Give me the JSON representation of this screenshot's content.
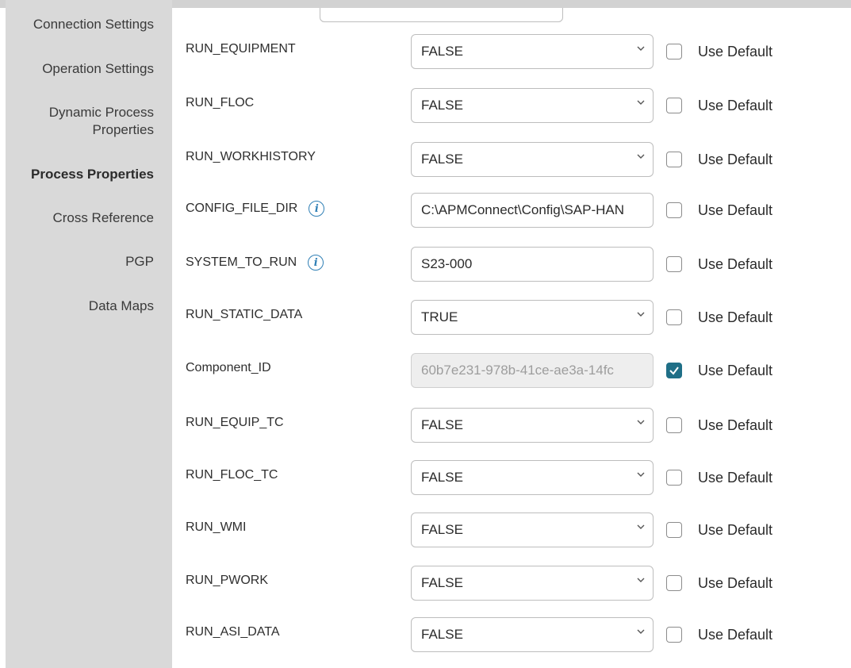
{
  "sidebar": {
    "items": [
      {
        "label": "Connection Settings",
        "active": false
      },
      {
        "label": "Operation Settings",
        "active": false
      },
      {
        "label": "Dynamic Process\nProperties",
        "active": false
      },
      {
        "label": "Process Properties",
        "active": true
      },
      {
        "label": "Cross Reference",
        "active": false
      },
      {
        "label": "PGP",
        "active": false
      },
      {
        "label": "Data Maps",
        "active": false
      }
    ]
  },
  "form": {
    "use_default_label": "Use Default",
    "rows": [
      {
        "name": "RUN_EQUIPMENT",
        "type": "select",
        "value": "FALSE",
        "info": false,
        "use_default": false
      },
      {
        "name": "RUN_FLOC",
        "type": "select",
        "value": "FALSE",
        "info": false,
        "use_default": false
      },
      {
        "name": "RUN_WORKHISTORY",
        "type": "select",
        "value": "FALSE",
        "info": false,
        "use_default": false
      },
      {
        "name": "CONFIG_FILE_DIR",
        "type": "text",
        "value": "C:\\APMConnect\\Config\\SAP-HAN",
        "info": true,
        "use_default": false
      },
      {
        "name": "SYSTEM_TO_RUN",
        "type": "text",
        "value": "S23-000",
        "info": true,
        "use_default": false
      },
      {
        "name": "RUN_STATIC_DATA",
        "type": "select",
        "value": "TRUE",
        "info": false,
        "use_default": false
      },
      {
        "name": "Component_ID",
        "type": "readonly",
        "value": "60b7e231-978b-41ce-ae3a-14fc",
        "info": false,
        "use_default": true
      },
      {
        "name": "RUN_EQUIP_TC",
        "type": "select",
        "value": "FALSE",
        "info": false,
        "use_default": false
      },
      {
        "name": "RUN_FLOC_TC",
        "type": "select",
        "value": "FALSE",
        "info": false,
        "use_default": false
      },
      {
        "name": "RUN_WMI",
        "type": "select",
        "value": "FALSE",
        "info": false,
        "use_default": false
      },
      {
        "name": "RUN_PWORK",
        "type": "select",
        "value": "FALSE",
        "info": false,
        "use_default": false
      },
      {
        "name": "RUN_ASI_DATA",
        "type": "select",
        "value": "FALSE",
        "info": false,
        "use_default": false
      }
    ]
  },
  "icons": {
    "info": "info-icon",
    "dropdown": "chevron-down-icon",
    "check": "checkmark-icon"
  },
  "colors": {
    "sidebar_bg": "#d9d9d9",
    "checkbox_checked": "#1f6f87",
    "info_icon": "#2f7fb5"
  }
}
